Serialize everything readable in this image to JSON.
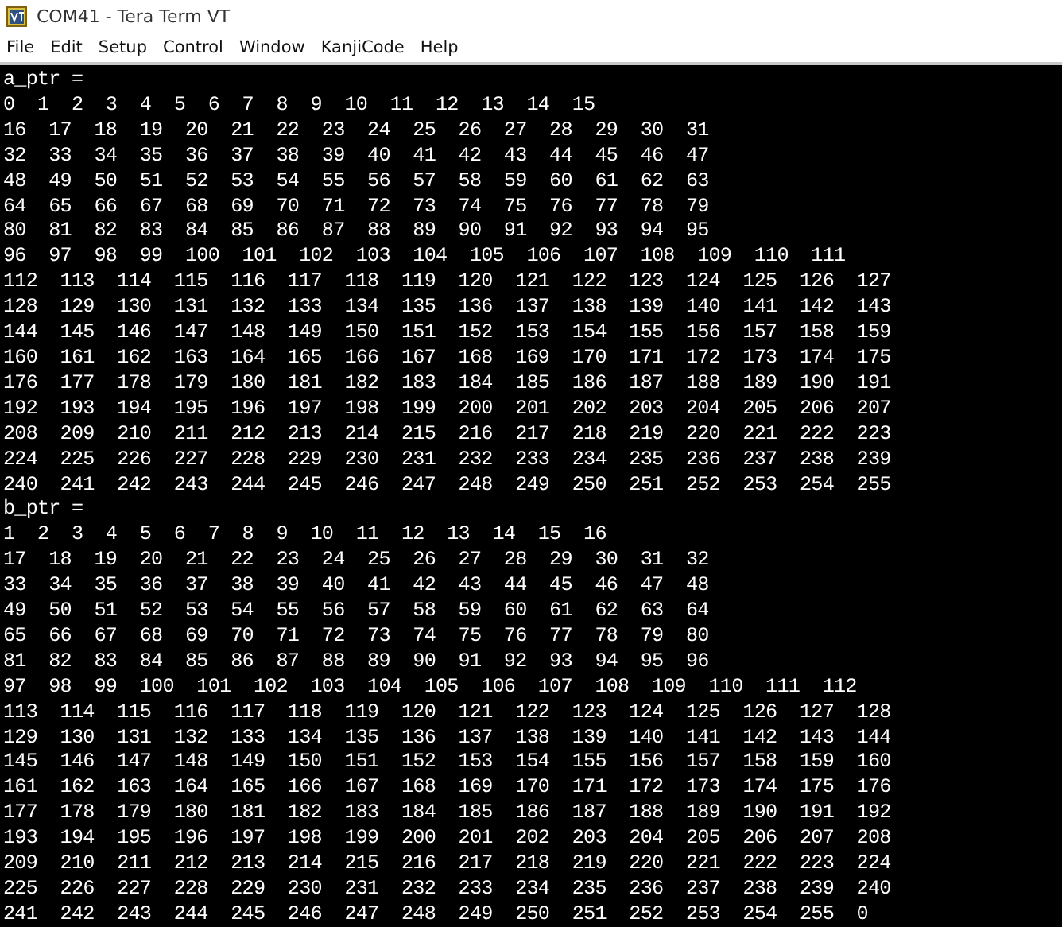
{
  "window": {
    "title": "COM41 - Tera Term VT"
  },
  "menu": [
    "File",
    "Edit",
    "Setup",
    "Control",
    "Window",
    "KanjiCode",
    "Help"
  ],
  "terminal": {
    "blocks": [
      {
        "header": "a_ptr =",
        "rows": [
          "0  1  2  3  4  5  6  7  8  9  10  11  12  13  14  15",
          "16  17  18  19  20  21  22  23  24  25  26  27  28  29  30  31",
          "32  33  34  35  36  37  38  39  40  41  42  43  44  45  46  47",
          "48  49  50  51  52  53  54  55  56  57  58  59  60  61  62  63",
          "64  65  66  67  68  69  70  71  72  73  74  75  76  77  78  79",
          "80  81  82  83  84  85  86  87  88  89  90  91  92  93  94  95",
          "96  97  98  99  100  101  102  103  104  105  106  107  108  109  110  111",
          "112  113  114  115  116  117  118  119  120  121  122  123  124  125  126  127",
          "128  129  130  131  132  133  134  135  136  137  138  139  140  141  142  143",
          "144  145  146  147  148  149  150  151  152  153  154  155  156  157  158  159",
          "160  161  162  163  164  165  166  167  168  169  170  171  172  173  174  175",
          "176  177  178  179  180  181  182  183  184  185  186  187  188  189  190  191",
          "192  193  194  195  196  197  198  199  200  201  202  203  204  205  206  207",
          "208  209  210  211  212  213  214  215  216  217  218  219  220  221  222  223",
          "224  225  226  227  228  229  230  231  232  233  234  235  236  237  238  239",
          "240  241  242  243  244  245  246  247  248  249  250  251  252  253  254  255"
        ]
      },
      {
        "header": "b_ptr =",
        "rows": [
          "1  2  3  4  5  6  7  8  9  10  11  12  13  14  15  16",
          "17  18  19  20  21  22  23  24  25  26  27  28  29  30  31  32",
          "33  34  35  36  37  38  39  40  41  42  43  44  45  46  47  48",
          "49  50  51  52  53  54  55  56  57  58  59  60  61  62  63  64",
          "65  66  67  68  69  70  71  72  73  74  75  76  77  78  79  80",
          "81  82  83  84  85  86  87  88  89  90  91  92  93  94  95  96",
          "97  98  99  100  101  102  103  104  105  106  107  108  109  110  111  112",
          "113  114  115  116  117  118  119  120  121  122  123  124  125  126  127  128",
          "129  130  131  132  133  134  135  136  137  138  139  140  141  142  143  144",
          "145  146  147  148  149  150  151  152  153  154  155  156  157  158  159  160",
          "161  162  163  164  165  166  167  168  169  170  171  172  173  174  175  176",
          "177  178  179  180  181  182  183  184  185  186  187  188  189  190  191  192",
          "193  194  195  196  197  198  199  200  201  202  203  204  205  206  207  208",
          "209  210  211  212  213  214  215  216  217  218  219  220  221  222  223  224",
          "225  226  227  228  229  230  231  232  233  234  235  236  237  238  239  240",
          "241  242  243  244  245  246  247  248  249  250  251  252  253  254  255  0"
        ]
      }
    ]
  }
}
